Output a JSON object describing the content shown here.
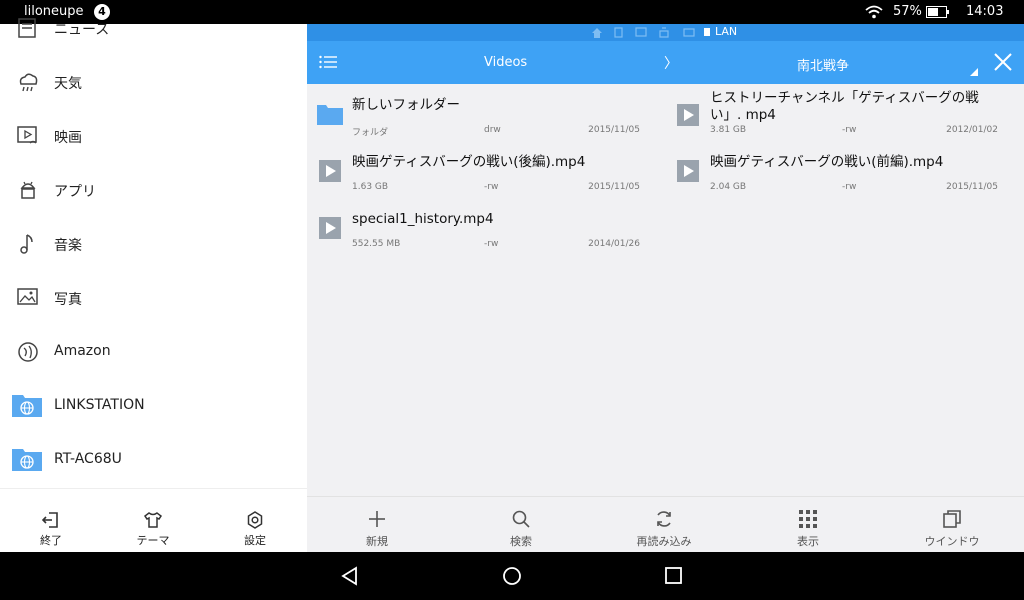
{
  "status": {
    "user": "liloneupe",
    "notification_count": "4",
    "battery_percent": "57%",
    "time": "14:03"
  },
  "drawer": {
    "items": [
      {
        "label": "ニュース",
        "icon": "news-icon"
      },
      {
        "label": "天気",
        "icon": "weather-icon"
      },
      {
        "label": "映画",
        "icon": "movie-icon"
      },
      {
        "label": "アプリ",
        "icon": "android-icon"
      },
      {
        "label": "音楽",
        "icon": "music-icon"
      },
      {
        "label": "写真",
        "icon": "photo-icon"
      },
      {
        "label": "Amazon",
        "icon": "amazon-icon"
      },
      {
        "label": "LINKSTATION",
        "icon": "network-folder-icon"
      },
      {
        "label": "RT-AC68U",
        "icon": "network-folder-icon"
      }
    ],
    "footer": {
      "exit_label": "終了",
      "theme_label": "テーマ",
      "settings_label": "設定"
    }
  },
  "main": {
    "crumb_label": "LAN",
    "tabs": [
      "Videos",
      "南北戦争"
    ],
    "tab_separator": "〉",
    "files": [
      {
        "name": "新しいフォルダー",
        "type": "フォルダ",
        "perm": "drw",
        "date": "2015/11/05",
        "kind": "folder"
      },
      {
        "name": "ヒストリーチャンネル「ゲティスバーグの戦い」. mp4",
        "type": "3.81 GB",
        "perm": "-rw",
        "date": "2012/01/02",
        "kind": "video"
      },
      {
        "name": "映画ゲティスバーグの戦い(後編).mp4",
        "type": "1.63 GB",
        "perm": "-rw",
        "date": "2015/11/05",
        "kind": "video"
      },
      {
        "name": "映画ゲティスバーグの戦い(前編).mp4",
        "type": "2.04 GB",
        "perm": "-rw",
        "date": "2015/11/05",
        "kind": "video"
      },
      {
        "name": "special1_history.mp4",
        "type": "552.55 MB",
        "perm": "-rw",
        "date": "2014/01/26",
        "kind": "video"
      }
    ],
    "actions": {
      "new_label": "新規",
      "search_label": "検索",
      "reload_label": "再読み込み",
      "view_label": "表示",
      "window_label": "ウインドウ"
    }
  },
  "colors": {
    "accent": "#3ea2f5",
    "accent_dark": "#2f90e6",
    "folder": "#5aa9f0",
    "pane_bg": "#f1f1f3"
  }
}
